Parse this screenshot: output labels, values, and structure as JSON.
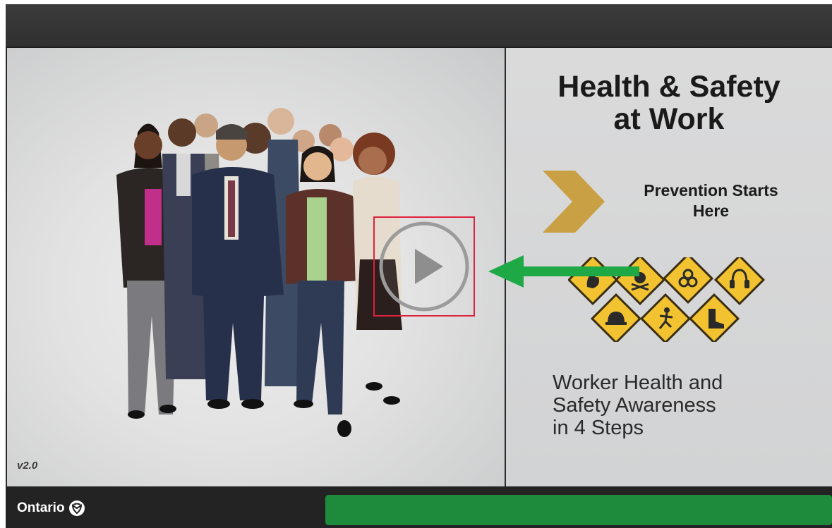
{
  "version_label": "v2.0",
  "title": {
    "line1": "Health & Safety",
    "line2": "at Work"
  },
  "tagline": {
    "line1": "Prevention Starts",
    "line2": "Here"
  },
  "subtitle": {
    "line1": "Worker Health and",
    "line2": "Safety Awareness",
    "line3": "in 4 Steps"
  },
  "branding": {
    "name": "Ontario",
    "logo_icon": "trillium-icon"
  },
  "play_button": {
    "icon": "play-icon",
    "highlight_color": "#e0213c"
  },
  "guide_arrow": {
    "icon": "arrow-left-icon",
    "color": "#1fa846"
  },
  "hazard_icons": [
    "flammable-icon",
    "toxic-skull-icon",
    "biohazard-icon",
    "hearing-protection-icon",
    "hard-hat-icon",
    "fall-hazard-icon",
    "safety-boot-icon"
  ],
  "progress": {
    "fraction": 1.0,
    "color": "#1e8a3b"
  },
  "colors": {
    "accent_gold": "#c9a043",
    "hazard_yellow": "#f2c230"
  }
}
